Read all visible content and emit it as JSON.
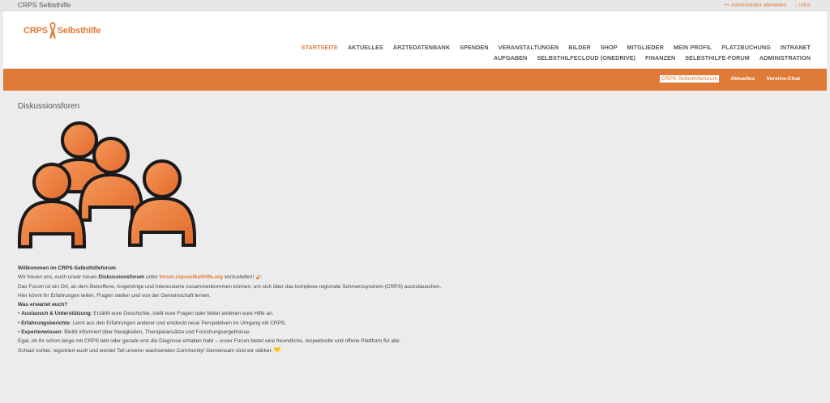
{
  "topbar": {
    "site_title": "CRPS Selbsthilfe",
    "logout_label": "Administrator abmelden",
    "info_label": "Infos"
  },
  "logo": {
    "left": "CRPS",
    "right": "Selbsthilfe"
  },
  "nav": {
    "row1": [
      "STARTSEITE",
      "AKTUELLES",
      "ÄRZTEDATENBANK",
      "SPENDEN",
      "VERANSTALTUNGEN",
      "BILDER",
      "SHOP",
      "MITGLIEDER",
      "MEIN PROFIL",
      "PLATZBUCHUNG",
      "INTRANET"
    ],
    "row2": [
      "AUFGABEN",
      "SELBSTHILFECLOUD (ONEDRIVE)",
      "FINANZEN",
      "SELBSTHILFE-FORUM",
      "ADMINISTRATION"
    ]
  },
  "subnav": [
    "CRPS Selbsthilfeforum",
    "Aktuelles",
    "Vereins-Chat"
  ],
  "page": {
    "title": "Diskussionsforen",
    "welcome_heading": "Willkommen im CRPS-Selbsthilfeforum",
    "intro_pre": "Wir freuen uns, euch unser neues ",
    "intro_bold": "Diskussionsforum",
    "intro_mid": " unter ",
    "intro_link": "forum.crpsselbsthilfe.org",
    "intro_post": " vorzustellen! ",
    "para1": "Das Forum ist ein Ort, an dem Betroffene, Angehörige und Interessierte zusammenkommen können, um sich über das komplexe regionale Schmerzsyndrom (CRPS) auszutauschen.",
    "para2": "Hier könnt ihr Erfahrungen teilen, Fragen stellen und von der Gemeinschaft lernen.",
    "expect_heading": "Was erwartet euch?",
    "bullets": [
      {
        "title": "Austausch & Unterstützung",
        "text": ": Erzählt eure Geschichte, stellt eure Fragen oder bietet anderen eure Hilfe an."
      },
      {
        "title": "Erfahrungsberichte",
        "text": ": Lernt aus den Erfahrungen anderer und entdeckt neue Perspektiven im Umgang mit CRPS."
      },
      {
        "title": "Expertenwissen",
        "text": ": Bleibt informiert über Neuigkeiten, Therapieansätze und Forschungsergebnisse."
      }
    ],
    "bullet_char": "•",
    "para3": "Egal, ob ihr schon lange mit CRPS lebt oder gerade erst die Diagnose erhalten habt – unser Forum bietet eine freundliche, respektvolle und offene Plattform für alle.",
    "para4": "Schaut vorbei, registriert euch und werdet Teil unserer wachsenden Community! Gemeinsam sind wir stärker. "
  },
  "colors": {
    "accent": "#e07a37",
    "background": "#ececec",
    "text": "#444444"
  },
  "icons": {
    "logout": "logout-icon",
    "info": "info-icon",
    "ribbon": "awareness-ribbon-icon",
    "people": "people-group-icon",
    "party": "party-popper-icon",
    "heart": "yellow-heart-icon"
  }
}
